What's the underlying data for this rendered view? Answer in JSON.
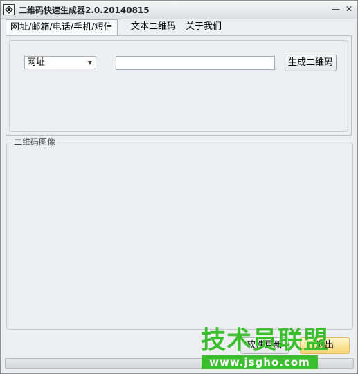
{
  "window": {
    "title": "二维码快速生成器2.0.20140815",
    "minimize_glyph": "—",
    "close_glyph": "✕"
  },
  "tabs": [
    {
      "label": "网址/邮箱/电话/手机/短信",
      "active": true
    },
    {
      "label": "文本二维码",
      "active": false
    },
    {
      "label": "关于我们",
      "active": false
    }
  ],
  "form": {
    "type_select_value": "网址",
    "url_input_value": "",
    "generate_button": "生成二维码"
  },
  "qr_section": {
    "legend": "二维码图像"
  },
  "footer": {
    "update_button": "软件更新",
    "exit_button": "退出"
  },
  "watermark": {
    "title": "技术员联盟",
    "url": "www.jsgho.com",
    "color": "#3cbf2e"
  },
  "icons": {
    "app": "app-icon",
    "minimize": "minimize-icon",
    "close": "close-icon",
    "dropdown": "chevron-down-icon"
  }
}
